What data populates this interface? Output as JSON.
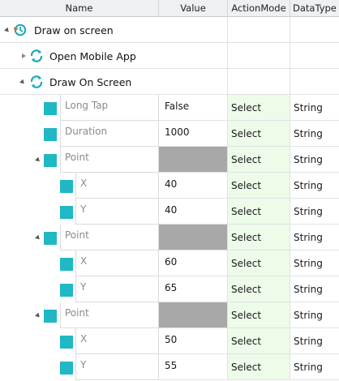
{
  "headers": {
    "name": "Name",
    "value": "Value",
    "action_mode": "ActionMode",
    "data_type": "DataType"
  },
  "tree": {
    "root": {
      "label": "Draw on screen",
      "icon": "flow-step-icon"
    },
    "open_app": {
      "label": "Open Mobile App",
      "icon": "refresh-cycle-icon"
    },
    "draw": {
      "label": "Draw On Screen",
      "icon": "refresh-cycle-icon"
    }
  },
  "params": [
    {
      "name": "Long Tap",
      "value": "False",
      "action": "Select",
      "type": "String"
    },
    {
      "name": "Duration",
      "value": "1000",
      "action": "Select",
      "type": "String"
    },
    {
      "name": "Point",
      "value": "",
      "action": "Select",
      "type": "String"
    },
    {
      "name": "X",
      "value": "40",
      "action": "Select",
      "type": "String"
    },
    {
      "name": "Y",
      "value": "40",
      "action": "Select",
      "type": "String"
    },
    {
      "name": "Point",
      "value": "",
      "action": "Select",
      "type": "String"
    },
    {
      "name": "X",
      "value": "60",
      "action": "Select",
      "type": "String"
    },
    {
      "name": "Y",
      "value": "65",
      "action": "Select",
      "type": "String"
    },
    {
      "name": "Point",
      "value": "",
      "action": "Select",
      "type": "String"
    },
    {
      "name": "X",
      "value": "50",
      "action": "Select",
      "type": "String"
    },
    {
      "name": "Y",
      "value": "55",
      "action": "Select",
      "type": "String"
    }
  ],
  "colors": {
    "param_square": "#1fb8c4",
    "action_bg": "#edfbe9",
    "disabled_value": "#a8a8a8",
    "header_bg": "#eef0f2"
  }
}
